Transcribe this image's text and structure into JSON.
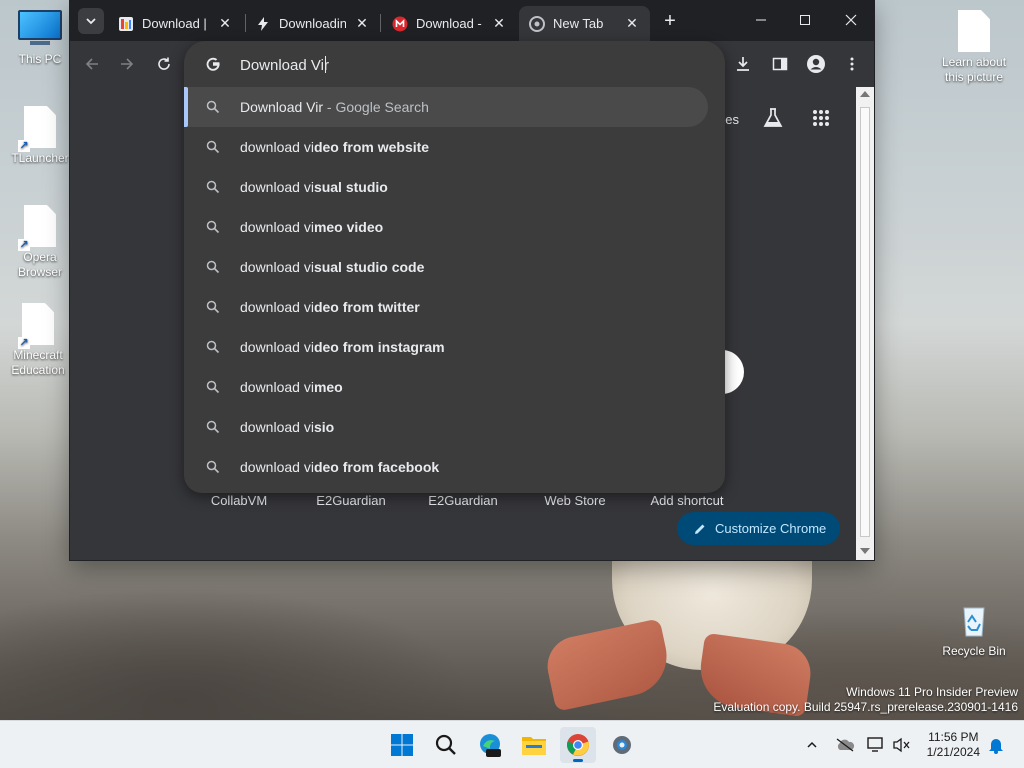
{
  "desktop": {
    "icons": [
      {
        "label": "This PC"
      },
      {
        "label": "TLauncher"
      },
      {
        "label": "Opera Browser"
      },
      {
        "label": "Minecraft Education"
      },
      {
        "label": "Learn about this picture"
      },
      {
        "label": "Recycle Bin"
      }
    ],
    "watermark": {
      "line1": "Windows 11 Pro Insider Preview",
      "line2": "Evaluation copy. Build 25947.rs_prerelease.230901-1416"
    }
  },
  "chrome": {
    "tabs": [
      {
        "title": "Download |",
        "icon": "google-docs-icon",
        "close": "✕"
      },
      {
        "title": "Downloadin",
        "icon": "lightning-icon",
        "close": "✕"
      },
      {
        "title": "Download -",
        "icon": "mega-icon",
        "close": "✕"
      },
      {
        "title": "New Tab",
        "icon": "chrome-icon",
        "close": "✕"
      }
    ],
    "new_tab_label": "+",
    "omnibox": {
      "value": "Download Vir",
      "suggestions": [
        {
          "prefix": "Download Vir",
          "bold": "",
          "suffix": " - Google Search",
          "selected": true
        },
        {
          "prefix": "download vi",
          "bold": "deo from website"
        },
        {
          "prefix": "download vi",
          "bold": "sual studio"
        },
        {
          "prefix": "download vi",
          "bold": "meo video"
        },
        {
          "prefix": "download vi",
          "bold": "sual studio code"
        },
        {
          "prefix": "download vi",
          "bold": "deo from twitter"
        },
        {
          "prefix": "download vi",
          "bold": "deo from instagram"
        },
        {
          "prefix": "download vi",
          "bold": "meo"
        },
        {
          "prefix": "download vi",
          "bold": "sio"
        },
        {
          "prefix": "download vi",
          "bold": "deo from facebook"
        }
      ]
    },
    "ntp": {
      "partial_images_label": "ges",
      "shortcuts": [
        "CollabVM",
        "E2Guardian",
        "E2Guardian",
        "Web Store",
        "Add shortcut"
      ],
      "customize_label": "Customize Chrome"
    }
  },
  "taskbar": {
    "time": "11:56 PM",
    "date": "1/21/2024"
  },
  "colors": {
    "accent": "#a8c7fa",
    "chrome_bg": "#35363a",
    "tabstrip": "#202124",
    "dropdown": "#3c3c3c",
    "customize_bg": "#004a77"
  }
}
